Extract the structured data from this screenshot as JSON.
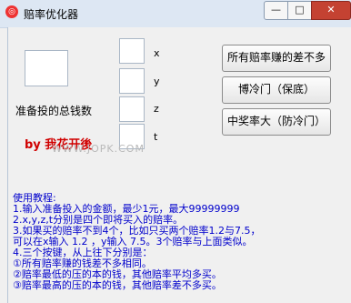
{
  "window": {
    "title": "赔率优化器",
    "minimize": "—",
    "maximize": "□",
    "close": "✕"
  },
  "labels": {
    "x": "x",
    "y": "y",
    "z": "z",
    "t": "t",
    "total_bet": "准备投的总钱数",
    "author": "by 我花开後",
    "watermark": "WWW.JOPK.COM"
  },
  "inputs": {
    "total": "",
    "x": "",
    "y": "",
    "z": "",
    "t": ""
  },
  "buttons": {
    "all_diff": "所有赔率赚的差不多",
    "cold": "博冷门（保底）",
    "win": "中奖率大（防冷门）"
  },
  "help": {
    "title": "使用教程:",
    "lines": [
      "1.输入准备投入的金额，最少1元，最大99999999",
      "2.x,y,z,t分别是四个即将买入的赔率。",
      "3.如果买的赔率不到4个，比如只买两个赔率1.2与7.5，",
      "  可以在x输入 1.2 ，y输入 7.5。3个赔率与上面类似。",
      "4.三个按键，从上往下分别是：",
      "  ①所有赔率赚的钱差不多相同。",
      "  ②赔率最低的压的本的钱，其他赔率平均多买。",
      "  ③赔率最高的压的本的钱，其他赔率差不多买。"
    ]
  }
}
